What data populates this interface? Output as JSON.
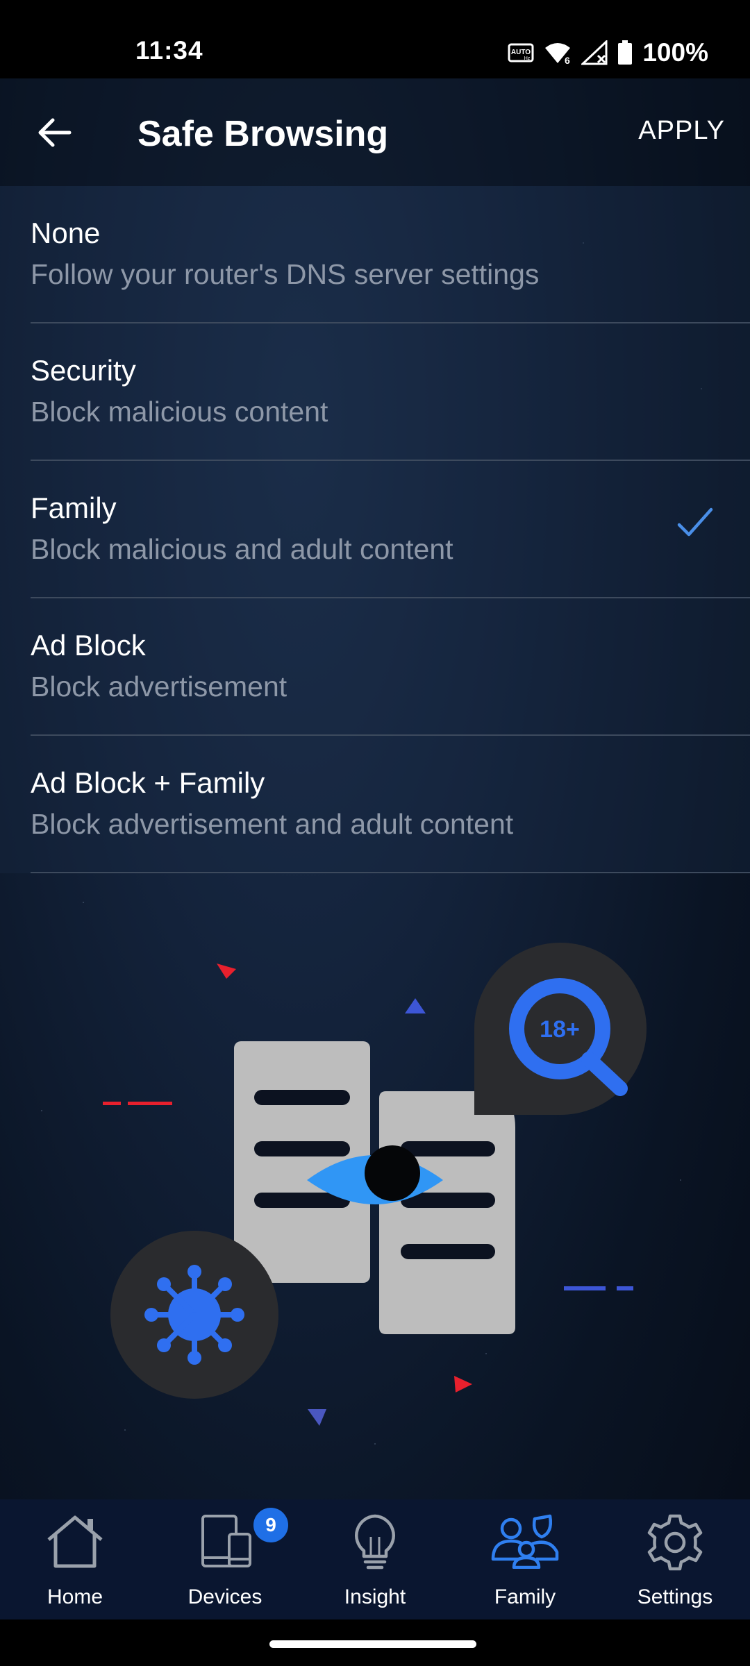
{
  "status_bar": {
    "time": "11:34",
    "battery_percent": "100%",
    "icons": [
      "auto-hz-icon",
      "wifi-6-icon",
      "no-signal-icon",
      "battery-icon"
    ]
  },
  "app_bar": {
    "title": "Safe Browsing",
    "apply_label": "APPLY"
  },
  "options": [
    {
      "title": "None",
      "subtitle": "Follow your router's DNS server settings",
      "selected": false
    },
    {
      "title": "Security",
      "subtitle": "Block malicious content",
      "selected": false
    },
    {
      "title": "Family",
      "subtitle": "Block malicious and adult content",
      "selected": true
    },
    {
      "title": "Ad Block",
      "subtitle": "Block advertisement",
      "selected": false
    },
    {
      "title": "Ad Block + Family",
      "subtitle": "Block advertisement and adult content",
      "selected": false
    }
  ],
  "illustration": {
    "badge_text": "18+"
  },
  "bottom_nav": {
    "active": "Family",
    "devices_badge": "9",
    "tabs": [
      {
        "label": "Home",
        "icon": "home-icon"
      },
      {
        "label": "Devices",
        "icon": "devices-icon"
      },
      {
        "label": "Insight",
        "icon": "lightbulb-icon"
      },
      {
        "label": "Family",
        "icon": "family-icon"
      },
      {
        "label": "Settings",
        "icon": "gear-icon"
      }
    ]
  },
  "colors": {
    "accent": "#2f7ff0",
    "checkmark": "#4a8fe8",
    "alert_red": "#e8202d",
    "nav_background": "#0a1630"
  }
}
